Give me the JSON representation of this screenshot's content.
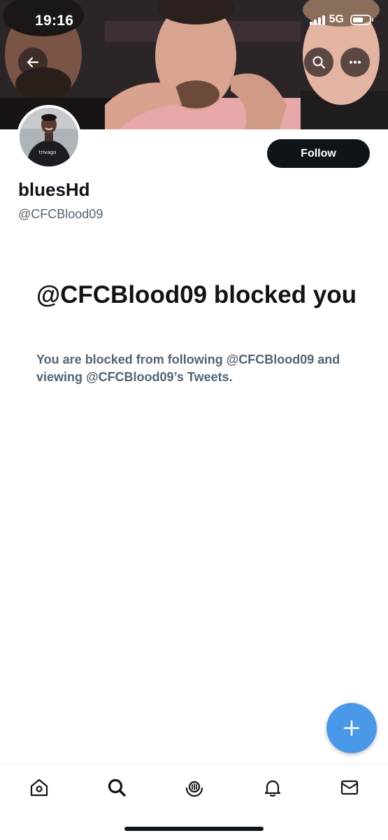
{
  "status_bar": {
    "time": "19:16",
    "network": "5G"
  },
  "header": {
    "back_icon": "arrow-left-icon",
    "search_icon": "search-icon",
    "more_icon": "more-icon"
  },
  "profile": {
    "display_name": "bluesHd",
    "handle": "@CFCBlood09",
    "follow_label": "Follow",
    "avatar_shirt_text": "trivago"
  },
  "blocked": {
    "title": "@CFCBlood09 blocked you",
    "description": "You are blocked from following @CFCBlood09 and viewing @CFCBlood09’s Tweets."
  },
  "fab": {
    "icon": "plus-icon"
  },
  "bottom_nav": {
    "items": [
      {
        "icon": "home-icon"
      },
      {
        "icon": "search-icon"
      },
      {
        "icon": "spaces-icon"
      },
      {
        "icon": "bell-icon"
      },
      {
        "icon": "mail-icon"
      }
    ]
  },
  "colors": {
    "accent": "#4a99e9",
    "text_primary": "#0f1419",
    "text_secondary": "#536471"
  }
}
